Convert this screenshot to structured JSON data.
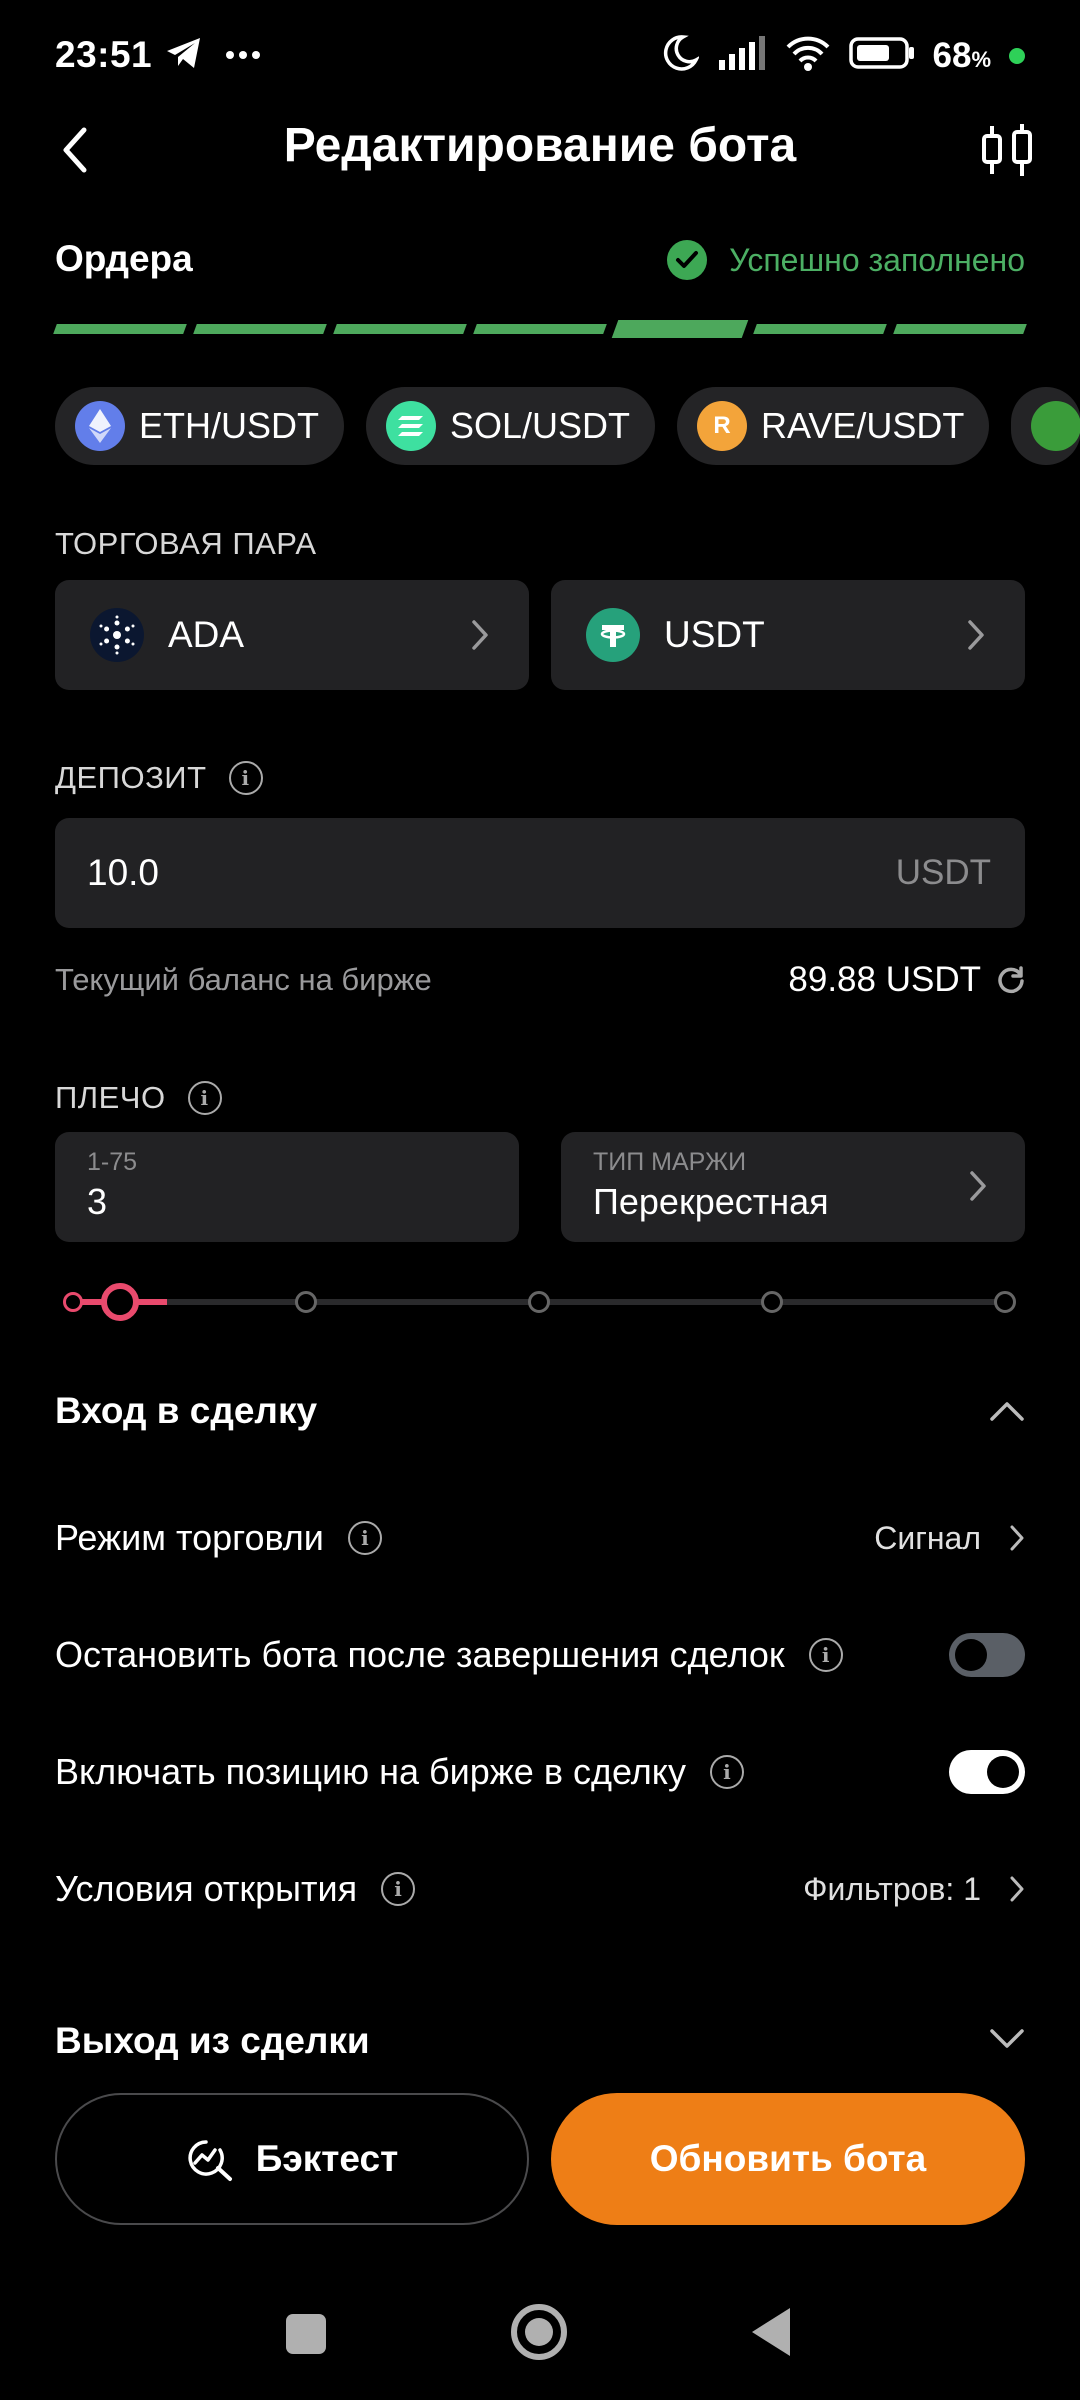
{
  "status_bar": {
    "time": "23:51",
    "battery_percent": "68",
    "battery_symbol": "%",
    "icons": [
      "telegram-icon",
      "more-icon",
      "moon-icon",
      "signal-icon",
      "wifi-icon",
      "battery-icon"
    ]
  },
  "header": {
    "title": "Редактирование бота"
  },
  "step": {
    "title": "Ордера",
    "status": "Успешно заполнено",
    "segments_total": 7,
    "active_segment": 5
  },
  "chips": [
    {
      "label": "ETH/USDT",
      "icon": "eth-icon",
      "color": "#627eea"
    },
    {
      "label": "SOL/USDT",
      "icon": "sol-icon",
      "color": "#3ee0a0"
    },
    {
      "label": "RAVE/USDT",
      "icon": "rave-icon",
      "color": "#f3a43a",
      "letter": "R"
    }
  ],
  "trading_pair": {
    "label": "ТОРГОВАЯ ПАРА",
    "base": "ADA",
    "quote": "USDT"
  },
  "deposit": {
    "label": "ДЕПОЗИТ",
    "value": "10.0",
    "unit": "USDT",
    "balance_label": "Текущий баланс на бирже",
    "balance_value": "89.88 USDT"
  },
  "leverage": {
    "label": "ПЛЕЧО",
    "range": "1-75",
    "value": "3",
    "margin_label": "ТИП МАРЖИ",
    "margin_value": "Перекрестная",
    "slider_min": 1,
    "slider_max": 75,
    "slider_value": 3
  },
  "entry_section": {
    "title": "Вход в сделку",
    "rows": {
      "trading_mode": {
        "label": "Режим торговли",
        "value": "Сигнал"
      },
      "stop_after": {
        "label": "Остановить бота после завершения сделок",
        "enabled": false
      },
      "include_position": {
        "label": "Включать позицию на бирже в сделку",
        "enabled": true
      },
      "open_conditions": {
        "label": "Условия открытия",
        "value": "Фильтров: 1"
      }
    }
  },
  "exit_section": {
    "title": "Выход из сделки"
  },
  "buttons": {
    "backtest": "Бэктест",
    "update": "Обновить бота"
  },
  "colors": {
    "accent_orange": "#ee7e16",
    "success_green": "#4caf64",
    "slider_pink": "#e94a6d"
  }
}
